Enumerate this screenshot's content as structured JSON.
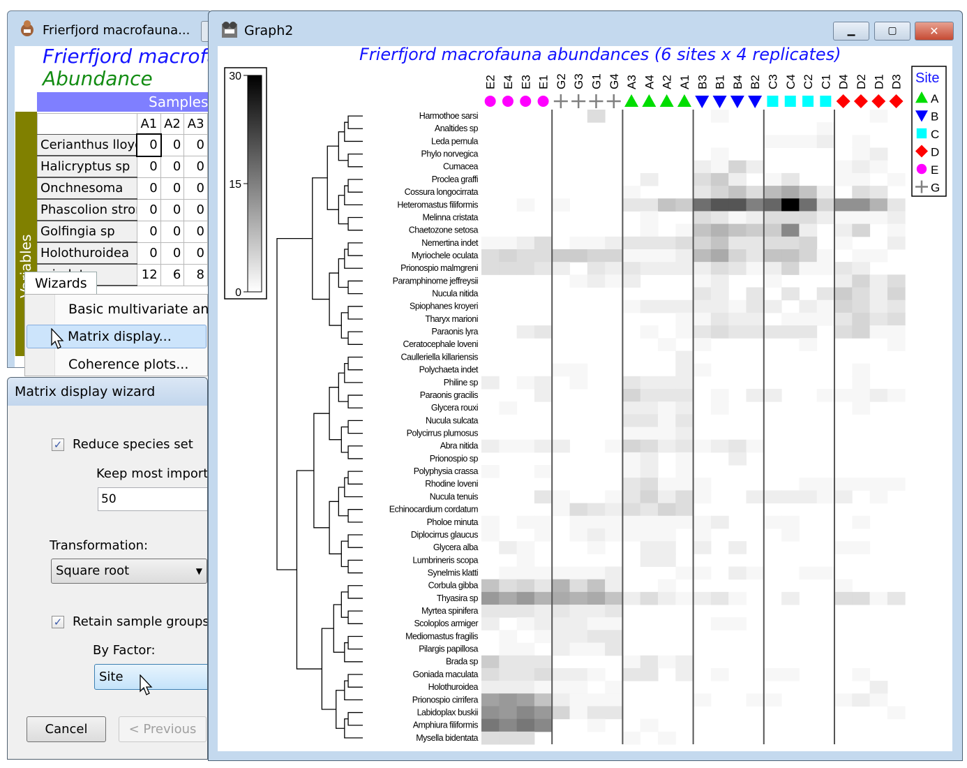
{
  "data_window": {
    "title": "Frierfjord macrofauna...",
    "sheet_title": "Frierfjord macrofauna",
    "sheet_subtitle": "Abundance",
    "samples_label": "Samples",
    "variables_label": "Variables",
    "columns": [
      "A1",
      "A2",
      "A3"
    ],
    "rows": [
      {
        "name": "Cerianthus lloydii",
        "values": [
          "0",
          "0",
          "0"
        ]
      },
      {
        "name": "Halicryptus sp",
        "values": [
          "0",
          "0",
          "0"
        ]
      },
      {
        "name": "Onchnesoma",
        "values": [
          "0",
          "0",
          "0"
        ]
      },
      {
        "name": "Phascolion strombi",
        "values": [
          "0",
          "0",
          "0"
        ]
      },
      {
        "name": "Golfingia sp",
        "values": [
          "0",
          "0",
          "0"
        ]
      },
      {
        "name": "Holothuroidea",
        "values": [
          "0",
          "0",
          "0"
        ]
      },
      {
        "name": "a indet",
        "values": [
          "12",
          "6",
          "8"
        ]
      }
    ],
    "menu_tab": "Wizards",
    "menu_items": [
      "Basic multivariate analysis",
      "Matrix display...",
      "Coherence plots..."
    ],
    "highlighted_item": "Matrix display..."
  },
  "wizard": {
    "title": "Matrix display wizard",
    "reduce_species_label": "Reduce species set",
    "reduce_species_checked": true,
    "keep_label": "Keep most important",
    "keep_value": "50",
    "transformation_label": "Transformation:",
    "transformation_value": "Square root",
    "retain_groups_label": "Retain sample groups",
    "retain_groups_checked": true,
    "factor_label": "By Factor:",
    "factor_value": "Site",
    "cancel_label": "Cancel",
    "previous_label": "< Previous"
  },
  "graph_window": {
    "title": "Graph2",
    "minimize": "minimize",
    "maximize": "maximize",
    "close": "✕"
  },
  "chart_data": {
    "type": "heatmap",
    "title": "Frierfjord macrofauna abundances (6 sites x 4 replicates)",
    "colorbar": {
      "min": 0,
      "max": 30,
      "ticks": [
        "30",
        "15",
        "0"
      ],
      "colormap": "white-to-black"
    },
    "samples": [
      "E2",
      "E4",
      "E3",
      "E1",
      "G2",
      "G3",
      "G1",
      "G4",
      "A3",
      "A4",
      "A2",
      "A1",
      "B3",
      "B1",
      "B4",
      "B2",
      "C3",
      "C4",
      "C2",
      "C1",
      "D4",
      "D2",
      "D1",
      "D3"
    ],
    "sample_groups": [
      "E",
      "E",
      "E",
      "E",
      "G",
      "G",
      "G",
      "G",
      "A",
      "A",
      "A",
      "A",
      "B",
      "B",
      "B",
      "B",
      "C",
      "C",
      "C",
      "C",
      "D",
      "D",
      "D",
      "D"
    ],
    "legend": {
      "title": "Site",
      "placement": "right",
      "entries": [
        {
          "label": "A",
          "symbol": "triangle-up",
          "color": "#00dd00"
        },
        {
          "label": "B",
          "symbol": "triangle-down",
          "color": "#0000ff"
        },
        {
          "label": "C",
          "symbol": "square",
          "color": "#00ffff"
        },
        {
          "label": "D",
          "symbol": "diamond",
          "color": "#ff0000"
        },
        {
          "label": "E",
          "symbol": "circle",
          "color": "#ff00ff"
        },
        {
          "label": "G",
          "symbol": "plus",
          "color": "#808080"
        }
      ]
    },
    "species": [
      "Harmothoe sarsi",
      "Analtides sp",
      "Leda pernula",
      "Phylo norvegica",
      "Cumacea",
      "Proclea graffi",
      "Cossura longocirrata",
      "Heteromastus filiformis",
      "Melinna cristata",
      "Chaetozone setosa",
      "Nemertina indet",
      "Myriochele oculata",
      "Prionospio malmgreni",
      "Paramphinome jeffreysii",
      "Nucula nitida",
      "Spiophanes kroyeri",
      "Tharyx marioni",
      "Paraonis lyra",
      "Ceratocephale loveni",
      "Caulleriella killariensis",
      "Polychaeta indet",
      "Philine sp",
      "Paraonis gracilis",
      "Glycera rouxi",
      "Nucula sulcata",
      "Polycirrus plumosus",
      "Abra nitida",
      "Prionospio sp",
      "Polyphysia crassa",
      "Rhodine loveni",
      "Nucula tenuis",
      "Echinocardium cordatum",
      "Pholoe minuta",
      "Diplocirrus glaucus",
      "Glycera alba",
      "Lumbrineris scopa",
      "Synelmis klatti",
      "Corbula gibba",
      "Thyasira sp",
      "Myrtea spinifera",
      "Scoloplos armiger",
      "Mediomastus fragilis",
      "Pilargis papillosa",
      "Brada sp",
      "Goniada maculata",
      "Holothuroidea",
      "Prionospio cirrifera",
      "Labidoplax buskii",
      "Amphiura filiformis",
      "Mysella bidentata"
    ],
    "values": [
      [
        0,
        0,
        0,
        0,
        0,
        0,
        4,
        0,
        0,
        0,
        0,
        0,
        0,
        1,
        0,
        0,
        0,
        0,
        0,
        0,
        0,
        0,
        1,
        0
      ],
      [
        0,
        0,
        0,
        0,
        0,
        0,
        0,
        0,
        0,
        0,
        0,
        0,
        0,
        0,
        0,
        0,
        0,
        0,
        0,
        1,
        0,
        0,
        0,
        0
      ],
      [
        0,
        0,
        0,
        0,
        0,
        0,
        0,
        0,
        0,
        0,
        0,
        0,
        0,
        0,
        0,
        0,
        1,
        1,
        1,
        2,
        0,
        1,
        0,
        0
      ],
      [
        0,
        0,
        0,
        0,
        0,
        0,
        0,
        0,
        0,
        0,
        0,
        0,
        0,
        1,
        0,
        0,
        0,
        0,
        0,
        0,
        0,
        1,
        2,
        0
      ],
      [
        0,
        0,
        0,
        0,
        0,
        0,
        0,
        0,
        0,
        0,
        0,
        0,
        2,
        1,
        5,
        2,
        0,
        0,
        0,
        0,
        1,
        2,
        1,
        0
      ],
      [
        0,
        0,
        0,
        0,
        0,
        0,
        0,
        0,
        0,
        2,
        0,
        0,
        4,
        6,
        2,
        0,
        1,
        3,
        0,
        0,
        1,
        1,
        0,
        1
      ],
      [
        0,
        0,
        0,
        0,
        0,
        0,
        0,
        0,
        1,
        0,
        0,
        0,
        3,
        5,
        7,
        4,
        8,
        10,
        7,
        2,
        0,
        4,
        3,
        0
      ],
      [
        0,
        0,
        1,
        0,
        1,
        0,
        0,
        0,
        3,
        3,
        7,
        6,
        17,
        20,
        20,
        15,
        18,
        30,
        17,
        5,
        13,
        13,
        9,
        3
      ],
      [
        0,
        0,
        0,
        0,
        0,
        0,
        0,
        0,
        0,
        1,
        0,
        0,
        4,
        3,
        1,
        2,
        4,
        4,
        4,
        2,
        1,
        1,
        1,
        2
      ],
      [
        0,
        0,
        0,
        0,
        0,
        0,
        0,
        0,
        0,
        1,
        0,
        1,
        7,
        9,
        7,
        6,
        6,
        14,
        2,
        0,
        2,
        5,
        0,
        1
      ],
      [
        1,
        1,
        2,
        4,
        0,
        1,
        1,
        2,
        3,
        3,
        3,
        4,
        5,
        7,
        3,
        3,
        4,
        4,
        5,
        0,
        1,
        0,
        0,
        2
      ],
      [
        4,
        5,
        4,
        4,
        6,
        6,
        5,
        5,
        1,
        1,
        1,
        2,
        8,
        10,
        5,
        3,
        7,
        7,
        5,
        1,
        0,
        1,
        1,
        0
      ],
      [
        4,
        4,
        4,
        3,
        2,
        0,
        3,
        2,
        3,
        2,
        2,
        2,
        2,
        4,
        3,
        1,
        2,
        5,
        1,
        1,
        3,
        2,
        0,
        0
      ],
      [
        0,
        0,
        0,
        0,
        0,
        1,
        2,
        1,
        2,
        0,
        0,
        0,
        1,
        2,
        0,
        0,
        1,
        0,
        0,
        0,
        2,
        5,
        2,
        4
      ],
      [
        0,
        0,
        0,
        0,
        0,
        0,
        0,
        0,
        0,
        0,
        0,
        0,
        3,
        2,
        0,
        3,
        0,
        3,
        0,
        3,
        6,
        4,
        2,
        5
      ],
      [
        0,
        0,
        0,
        0,
        0,
        0,
        0,
        0,
        1,
        2,
        2,
        2,
        2,
        2,
        1,
        3,
        2,
        0,
        2,
        1,
        5,
        4,
        2,
        3
      ],
      [
        0,
        0,
        0,
        0,
        0,
        0,
        0,
        0,
        0,
        0,
        0,
        1,
        1,
        3,
        2,
        2,
        0,
        1,
        1,
        1,
        3,
        5,
        3,
        4
      ],
      [
        0,
        0,
        2,
        3,
        0,
        0,
        0,
        0,
        0,
        1,
        0,
        1,
        3,
        4,
        3,
        3,
        3,
        3,
        3,
        0,
        4,
        5,
        1,
        1
      ],
      [
        0,
        0,
        0,
        0,
        0,
        0,
        0,
        0,
        0,
        0,
        1,
        0,
        1,
        0,
        0,
        0,
        0,
        0,
        1,
        0,
        0,
        0,
        0,
        1
      ],
      [
        0,
        0,
        0,
        0,
        0,
        0,
        0,
        0,
        0,
        0,
        0,
        2,
        0,
        0,
        0,
        0,
        0,
        0,
        0,
        0,
        0,
        0,
        0,
        0
      ],
      [
        0,
        0,
        0,
        0,
        1,
        1,
        0,
        0,
        0,
        0,
        0,
        2,
        1,
        0,
        0,
        0,
        0,
        0,
        0,
        0,
        0,
        1,
        0,
        0
      ],
      [
        2,
        0,
        1,
        2,
        0,
        1,
        0,
        0,
        3,
        2,
        2,
        2,
        0,
        0,
        0,
        0,
        0,
        0,
        0,
        0,
        0,
        1,
        0,
        0
      ],
      [
        0,
        0,
        0,
        2,
        0,
        0,
        0,
        0,
        5,
        3,
        3,
        3,
        0,
        1,
        0,
        2,
        2,
        0,
        0,
        1,
        1,
        1,
        2,
        1
      ],
      [
        0,
        1,
        0,
        0,
        0,
        0,
        0,
        0,
        2,
        2,
        1,
        2,
        0,
        1,
        0,
        0,
        0,
        0,
        0,
        0,
        0,
        1,
        0,
        0
      ],
      [
        0,
        0,
        0,
        0,
        0,
        0,
        0,
        0,
        3,
        3,
        1,
        3,
        0,
        0,
        0,
        0,
        0,
        0,
        0,
        0,
        0,
        0,
        0,
        0
      ],
      [
        0,
        0,
        0,
        0,
        0,
        0,
        0,
        0,
        1,
        1,
        1,
        2,
        0,
        0,
        0,
        0,
        0,
        0,
        0,
        0,
        0,
        0,
        0,
        0
      ],
      [
        2,
        1,
        1,
        2,
        2,
        0,
        0,
        1,
        5,
        4,
        2,
        3,
        1,
        2,
        3,
        1,
        0,
        0,
        0,
        0,
        0,
        0,
        0,
        0
      ],
      [
        0,
        0,
        0,
        0,
        0,
        0,
        0,
        0,
        1,
        2,
        0,
        1,
        0,
        0,
        2,
        0,
        0,
        0,
        0,
        0,
        0,
        0,
        0,
        0
      ],
      [
        1,
        0,
        0,
        1,
        0,
        0,
        0,
        0,
        1,
        2,
        0,
        1,
        0,
        0,
        0,
        0,
        0,
        0,
        0,
        0,
        0,
        0,
        0,
        0
      ],
      [
        0,
        0,
        0,
        0,
        0,
        0,
        0,
        0,
        3,
        4,
        1,
        1,
        1,
        0,
        0,
        0,
        0,
        0,
        1,
        1,
        1,
        1,
        1,
        1
      ],
      [
        0,
        0,
        0,
        3,
        1,
        0,
        0,
        1,
        3,
        5,
        2,
        4,
        1,
        0,
        0,
        2,
        2,
        2,
        2,
        1,
        2,
        0,
        1,
        0
      ],
      [
        0,
        0,
        0,
        0,
        1,
        4,
        3,
        2,
        4,
        3,
        5,
        4,
        0,
        0,
        0,
        0,
        0,
        0,
        0,
        0,
        0,
        0,
        0,
        0
      ],
      [
        1,
        0,
        1,
        1,
        0,
        1,
        1,
        1,
        1,
        1,
        1,
        1,
        1,
        2,
        0,
        0,
        1,
        1,
        0,
        0,
        0,
        1,
        0,
        0
      ],
      [
        1,
        0,
        0,
        1,
        0,
        1,
        2,
        1,
        1,
        1,
        1,
        0,
        1,
        0,
        0,
        0,
        0,
        1,
        0,
        0,
        0,
        0,
        0,
        0
      ],
      [
        0,
        2,
        1,
        0,
        0,
        0,
        1,
        0,
        0,
        2,
        2,
        0,
        2,
        0,
        2,
        0,
        0,
        0,
        0,
        0,
        1,
        1,
        0,
        0
      ],
      [
        0,
        0,
        1,
        0,
        0,
        0,
        0,
        0,
        0,
        2,
        2,
        0,
        0,
        0,
        0,
        0,
        0,
        0,
        0,
        0,
        0,
        0,
        0,
        0
      ],
      [
        0,
        1,
        1,
        1,
        1,
        1,
        1,
        2,
        0,
        0,
        0,
        1,
        1,
        0,
        2,
        1,
        0,
        0,
        1,
        1,
        0,
        0,
        0,
        0
      ],
      [
        7,
        4,
        5,
        3,
        9,
        4,
        7,
        2,
        0,
        0,
        1,
        0,
        0,
        0,
        0,
        0,
        0,
        0,
        0,
        0,
        1,
        0,
        0,
        0
      ],
      [
        12,
        10,
        12,
        9,
        10,
        9,
        10,
        7,
        2,
        4,
        2,
        1,
        2,
        3,
        1,
        0,
        0,
        2,
        0,
        0,
        4,
        4,
        1,
        3
      ],
      [
        3,
        3,
        3,
        2,
        3,
        2,
        2,
        3,
        0,
        0,
        0,
        0,
        0,
        0,
        0,
        0,
        0,
        0,
        0,
        0,
        0,
        0,
        0,
        0
      ],
      [
        2,
        0,
        1,
        2,
        2,
        2,
        1,
        1,
        0,
        0,
        0,
        0,
        0,
        1,
        1,
        0,
        0,
        0,
        0,
        0,
        0,
        0,
        0,
        0
      ],
      [
        0,
        1,
        0,
        1,
        2,
        2,
        3,
        3,
        0,
        0,
        0,
        0,
        0,
        0,
        0,
        0,
        0,
        0,
        0,
        0,
        0,
        0,
        0,
        0
      ],
      [
        0,
        1,
        1,
        0,
        2,
        1,
        1,
        3,
        0,
        0,
        0,
        0,
        0,
        0,
        0,
        0,
        0,
        0,
        0,
        0,
        0,
        0,
        0,
        0
      ],
      [
        6,
        3,
        3,
        3,
        0,
        0,
        0,
        0,
        1,
        3,
        1,
        2,
        0,
        0,
        0,
        0,
        0,
        0,
        0,
        0,
        0,
        0,
        0,
        0
      ],
      [
        4,
        3,
        3,
        4,
        2,
        2,
        1,
        0,
        3,
        3,
        0,
        2,
        0,
        1,
        0,
        0,
        1,
        1,
        0,
        0,
        0,
        1,
        0,
        0
      ],
      [
        2,
        2,
        2,
        1,
        1,
        1,
        0,
        1,
        0,
        0,
        0,
        0,
        0,
        0,
        0,
        0,
        0,
        0,
        0,
        0,
        0,
        0,
        2,
        0
      ],
      [
        11,
        12,
        11,
        7,
        2,
        1,
        1,
        1,
        0,
        0,
        0,
        0,
        1,
        0,
        0,
        1,
        1,
        0,
        0,
        0,
        1,
        2,
        1,
        0
      ],
      [
        13,
        12,
        14,
        12,
        5,
        1,
        3,
        3,
        0,
        0,
        0,
        0,
        0,
        0,
        0,
        0,
        0,
        0,
        0,
        0,
        0,
        0,
        0,
        1
      ],
      [
        16,
        14,
        16,
        14,
        0,
        0,
        1,
        0,
        0,
        1,
        0,
        0,
        0,
        0,
        0,
        0,
        0,
        0,
        0,
        0,
        0,
        0,
        0,
        0
      ],
      [
        4,
        4,
        4,
        0,
        0,
        0,
        0,
        0,
        1,
        0,
        1,
        0,
        0,
        0,
        0,
        0,
        0,
        0,
        0,
        0,
        0,
        0,
        0,
        0
      ]
    ]
  }
}
